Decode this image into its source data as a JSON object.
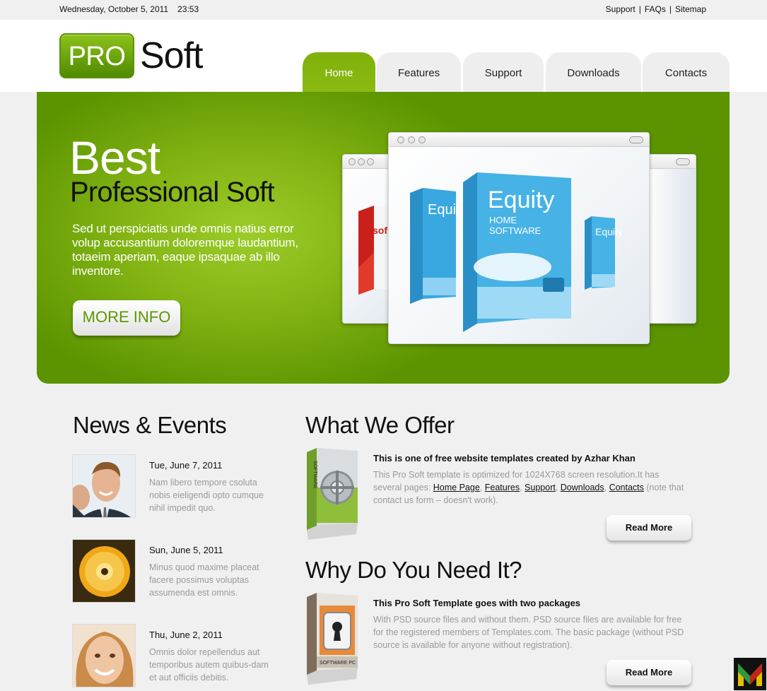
{
  "topbar": {
    "date": "Wednesday, October 5, 2011",
    "time": "23:53",
    "links": [
      "Support",
      "FAQs",
      "Sitemap"
    ]
  },
  "logo": {
    "badge": "PRO",
    "text": "Soft"
  },
  "nav": {
    "tabs": [
      {
        "label": "Home",
        "active": true
      },
      {
        "label": "Features",
        "active": false
      },
      {
        "label": "Support",
        "active": false
      },
      {
        "label": "Downloads",
        "active": false
      },
      {
        "label": "Contacts",
        "active": false
      }
    ]
  },
  "hero": {
    "title": "Best",
    "subtitle": "Professional Soft",
    "description": "Sed ut perspiciatis unde omnis natius error volup accusantium doloremque laudantium, totaeim aperiam, eaque ipsaquae ab illo inventore.",
    "button": "MORE INFO",
    "product": {
      "brand": "Equity",
      "line1": "HOME",
      "line2": "SOFTWARE",
      "side_brand": "sof"
    }
  },
  "news": {
    "heading": "News & Events",
    "items": [
      {
        "date": "Tue, June 7, 2011",
        "text": "Nam libero tempore csoluta nobis eieligendi opto cumque nihil impedit quo."
      },
      {
        "date": "Sun, June 5, 2011",
        "text": "Minus quod maxime placeat facere possimus voluptas assumenda est omnis."
      },
      {
        "date": "Thu, June 2, 2011",
        "text": "Omnis dolor repellendus aut temporibus autem quibus-dam et aut officiis debitis."
      }
    ]
  },
  "offer": {
    "heading": "What We Offer",
    "title": "This is one of free website templates created by Azhar Khan",
    "text_before": "This Pro Soft template is optimized for 1024X768 screen resolution.It has several pages: ",
    "links": [
      "Home Page",
      "Features",
      "Support",
      "Downloads",
      "Contacts"
    ],
    "text_after": " (note that contact us form – doesn't work).",
    "button": "Read More",
    "box_label": "SOFTWARE"
  },
  "why": {
    "heading": "Why Do You Need It?",
    "title": "This Pro Soft Template goes with two packages",
    "text": "With PSD source files and without them. PSD source files are available for free for the registered members of Templates.com. The basic package (without PSD source is available for anyone without registration).",
    "button": "Read More",
    "box_label": "SOFTWARE PC"
  },
  "colors": {
    "accent": "#7fb10a",
    "accent_dark": "#5b9400",
    "muted_text": "#9a9a9a"
  }
}
